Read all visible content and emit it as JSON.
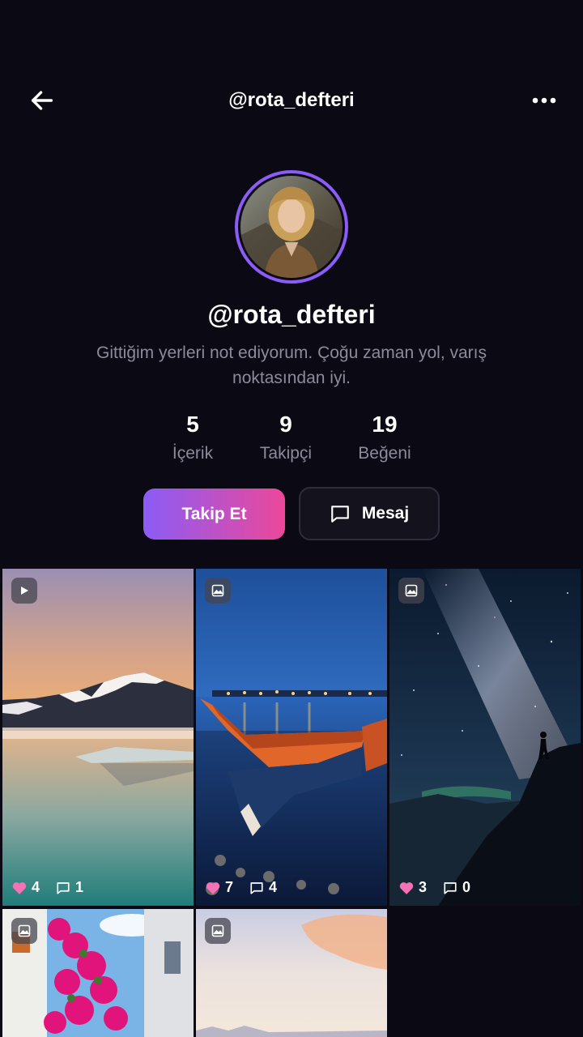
{
  "header": {
    "title": "@rota_defteri"
  },
  "profile": {
    "username": "@rota_defteri",
    "bio": "Gittiğim yerleri not ediyorum. Çoğu zaman yol, varış noktasından iyi."
  },
  "stats": [
    {
      "value": "5",
      "label": "İçerik"
    },
    {
      "value": "9",
      "label": "Takipçi"
    },
    {
      "value": "19",
      "label": "Beğeni"
    }
  ],
  "actions": {
    "follow_label": "Takip Et",
    "message_label": "Mesaj"
  },
  "posts": [
    {
      "type": "video",
      "type_icon": "play-icon",
      "likes": "4",
      "comments": "1"
    },
    {
      "type": "image",
      "type_icon": "image-icon",
      "likes": "7",
      "comments": "4"
    },
    {
      "type": "image",
      "type_icon": "image-icon",
      "likes": "3",
      "comments": "0"
    },
    {
      "type": "image",
      "type_icon": "image-icon"
    },
    {
      "type": "image",
      "type_icon": "image-icon"
    }
  ],
  "colors": {
    "accent_start": "#8b5cf6",
    "accent_end": "#ec4899",
    "like": "#f472b6",
    "background": "#0b0914"
  }
}
